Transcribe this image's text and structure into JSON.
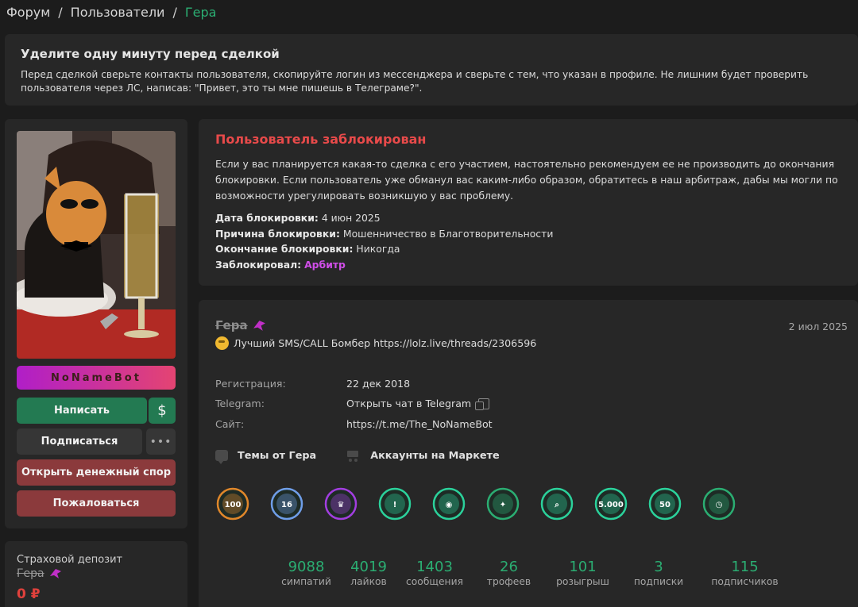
{
  "breadcrumb": {
    "forum": "Форум",
    "sep1": "/",
    "users": "Пользователи",
    "sep2": "/",
    "current": "Гера"
  },
  "notice": {
    "title": "Уделите одну минуту перед сделкой",
    "text": "Перед сделкой сверьте контакты пользователя, скопируйте логин из мессенджера и сверьте с тем, что указан в профиле. Не лишним будет проверить пользователя через ЛС, написав: \"Привет, это ты мне пишешь в Телеграме?\"."
  },
  "sidebar": {
    "username_bar": "NoNameBot",
    "write": "Написать",
    "money_icon": "$",
    "subscribe": "Подписаться",
    "more": "•••",
    "dispute": "Открыть денежный спор",
    "report": "Пожаловаться"
  },
  "deposit": {
    "label": "Страховой депозит",
    "name": "Гера",
    "amount": "0 ₽"
  },
  "ban": {
    "title": "Пользователь заблокирован",
    "text": "Если у вас планируется какая-то сделка с его участием, настоятельно рекомендуем ее не производить до окончания блокировки. Если пользователь уже обманул вас каким-либо образом, обратитесь в наш арбитраж, дабы мы могли по возможности урегулировать возникшую у вас проблему.",
    "date_label": "Дата блокировки:",
    "date_value": "4 июн 2025",
    "reason_label": "Причина блокировки:",
    "reason_value": "Мошенничество в Благотворительности",
    "end_label": "Окончание блокировки:",
    "end_value": "Никогда",
    "by_label": "Заблокировал:",
    "by_value": "Арбитр"
  },
  "profile": {
    "name": "Гера",
    "date": "2 июл 2025",
    "status": "Лучший SMS/CALL Бомбер https://lolz.live/threads/2306596",
    "reg_label": "Регистрация:",
    "reg_value": "22 дек 2018",
    "tg_label": "Telegram:",
    "tg_value": "Открыть чат в Telegram",
    "site_label": "Сайт:",
    "site_value": "https://t.me/The_NoNameBot",
    "threads_link": "Темы от Гера",
    "market_link": "Аккаунты на Маркете"
  },
  "trophies": [
    {
      "icon": "trophy-100-giveaways-icon",
      "color": "#e0872a",
      "label": "100"
    },
    {
      "icon": "trophy-shield-icon",
      "color": "#6f9ee8",
      "label": "16"
    },
    {
      "icon": "trophy-purple-icon",
      "color": "#a23ee0",
      "label": "♛"
    },
    {
      "icon": "trophy-triangle-icon",
      "color": "#2bd19b",
      "label": "!"
    },
    {
      "icon": "trophy-eye-icon",
      "color": "#2bd19b",
      "label": "◉"
    },
    {
      "icon": "trophy-dark-icon",
      "color": "#2bad72",
      "label": "✦"
    },
    {
      "icon": "trophy-detective-icon",
      "color": "#2bd19b",
      "label": "⌕"
    },
    {
      "icon": "trophy-5000-icon",
      "color": "#2bd19b",
      "label": "5.000"
    },
    {
      "icon": "trophy-50-icon",
      "color": "#2bd19b",
      "label": "50"
    },
    {
      "icon": "trophy-active-icon",
      "color": "#2bad72",
      "label": "◷"
    }
  ],
  "stats": [
    {
      "num": "9088",
      "label": "симпатий"
    },
    {
      "num": "4019",
      "label": "лайков"
    },
    {
      "num": "1403",
      "label": "сообщения"
    },
    {
      "num": "26",
      "label": "трофеев"
    },
    {
      "num": "101",
      "label": "розыгрыш"
    },
    {
      "num": "3",
      "label": "подписки"
    },
    {
      "num": "115",
      "label": "подписчиков"
    }
  ]
}
